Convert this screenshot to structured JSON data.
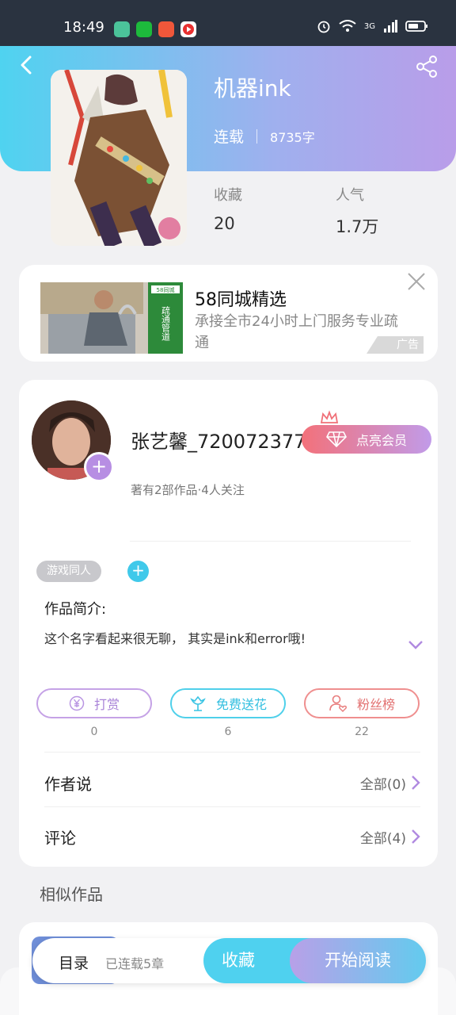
{
  "status_bar": {
    "time": "18:49",
    "network_label": "3G"
  },
  "header": {
    "title": "机器ink",
    "status": "连载",
    "word_count": "8735字"
  },
  "stats": [
    {
      "label": "收藏",
      "value": "20"
    },
    {
      "label": "人气",
      "value": "1.7万"
    }
  ],
  "ad": {
    "title": "58同城精选",
    "description": "承接全市24小时上门服务专业疏通",
    "tag": "广告",
    "image_panel_text": "疏通管道",
    "image_brand": "58同城"
  },
  "author": {
    "name": "张艺馨_720072377",
    "stats": "著有2部作品·4人关注",
    "vip_label": "点亮会员",
    "plus_glyph": "+"
  },
  "tags": {
    "items": [
      "游戏同人"
    ],
    "add_glyph": "+"
  },
  "intro": {
    "label": "作品简介:",
    "text": "这个名字看起来很无聊， 其实是ink和error哦!"
  },
  "actions": [
    {
      "label": "打赏",
      "count": "0",
      "color": "#c5a2e6",
      "text_color": "#a983d8"
    },
    {
      "label": "免费送花",
      "count": "6",
      "color": "#4fd0ea",
      "text_color": "#33bfe0"
    },
    {
      "label": "粉丝榜",
      "count": "22",
      "color": "#ef8f8f",
      "text_color": "#e27070"
    }
  ],
  "rows": [
    {
      "label": "作者说",
      "value": "全部(0)"
    },
    {
      "label": "评论",
      "value": "全部(4)"
    }
  ],
  "similar": {
    "title": "相似作品"
  },
  "bottom_bar": {
    "toc_label": "目录",
    "chapter_status": "已连载5章",
    "favorite_label": "收藏",
    "read_label": "开始阅读"
  },
  "colors": {
    "accent_cyan": "#4fd1ef",
    "accent_purple": "#b99de9",
    "vip_red": "#f3717a"
  }
}
